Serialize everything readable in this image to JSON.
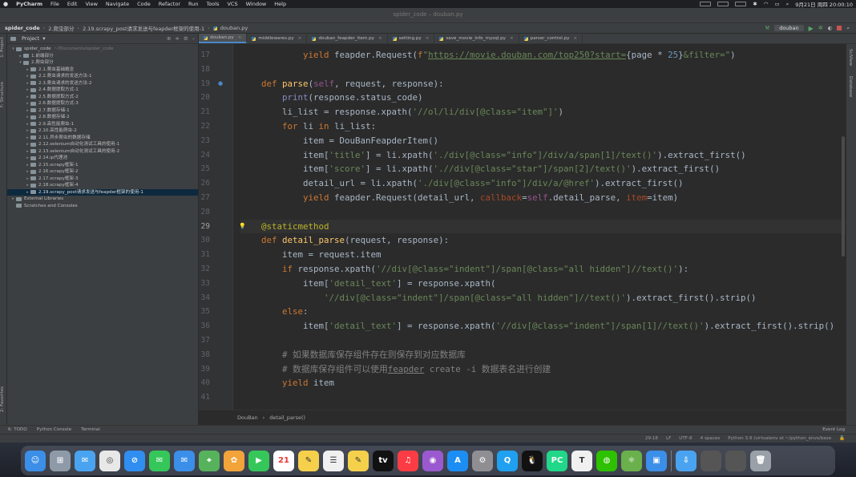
{
  "menubar": {
    "apple": "",
    "app": "PyCharm",
    "items": [
      "File",
      "Edit",
      "View",
      "Navigate",
      "Code",
      "Refactor",
      "Run",
      "Tools",
      "VCS",
      "Window",
      "Help"
    ],
    "datetime": "9月21日 周四  20:00:10"
  },
  "window": {
    "title": "spider_code – douban.py"
  },
  "navbar": {
    "crumbs": [
      "spider_code",
      "2.爬虫部分",
      "2.19.scrapy_post请求发送与feapder框架的使用-1",
      "douban.py"
    ],
    "run_config": "douban"
  },
  "project": {
    "header": "Project",
    "tree": [
      {
        "indent": 0,
        "arrow": "▾",
        "label": "spider_code",
        "muted": "~/Documents/spider_code"
      },
      {
        "indent": 1,
        "arrow": "▸",
        "label": "1.前端部分"
      },
      {
        "indent": 1,
        "arrow": "▾",
        "label": "2.爬虫部分"
      },
      {
        "indent": 2,
        "arrow": "▸",
        "label": "2.1.爬虫基础概念"
      },
      {
        "indent": 2,
        "arrow": "▸",
        "label": "2.2.爬虫请求的发送方法-1"
      },
      {
        "indent": 2,
        "arrow": "▸",
        "label": "2.3.爬虫请求的发送方法-2"
      },
      {
        "indent": 2,
        "arrow": "▸",
        "label": "2.4.数据提取方式-1"
      },
      {
        "indent": 2,
        "arrow": "▸",
        "label": "2.5.数据提取方式-2"
      },
      {
        "indent": 2,
        "arrow": "▸",
        "label": "2.6.数据提取方式-3"
      },
      {
        "indent": 2,
        "arrow": "▸",
        "label": "2.7.数据存储-1"
      },
      {
        "indent": 2,
        "arrow": "▸",
        "label": "2.8.数据存储-2"
      },
      {
        "indent": 2,
        "arrow": "▸",
        "label": "2.9.高性能爬虫-1"
      },
      {
        "indent": 2,
        "arrow": "▸",
        "label": "2.10.高性能爬虫-2"
      },
      {
        "indent": 2,
        "arrow": "▸",
        "label": "2.11.异步爬虫的数据存储"
      },
      {
        "indent": 2,
        "arrow": "▸",
        "label": "2.12.selenium自动化测试工具的使用-1"
      },
      {
        "indent": 2,
        "arrow": "▸",
        "label": "2.13.selenium自动化测试工具的使用-2"
      },
      {
        "indent": 2,
        "arrow": "▸",
        "label": "2.14.ip代理池"
      },
      {
        "indent": 2,
        "arrow": "▸",
        "label": "2.15.scrapy框架-1"
      },
      {
        "indent": 2,
        "arrow": "▸",
        "label": "2.16.scrapy框架-2"
      },
      {
        "indent": 2,
        "arrow": "▸",
        "label": "2.17.scrapy框架-3"
      },
      {
        "indent": 2,
        "arrow": "▸",
        "label": "2.18.scrapy框架-4"
      },
      {
        "indent": 2,
        "arrow": "▸",
        "label": "2.19.scrapy_post请求发送与feapder框架的使用-1",
        "selected": true
      },
      {
        "indent": 0,
        "arrow": "▸",
        "label": "External Libraries"
      },
      {
        "indent": 0,
        "arrow": "",
        "label": "Scratches and Consoles"
      }
    ]
  },
  "tabs": [
    {
      "label": "douban.py",
      "active": true
    },
    {
      "label": "middlewares.py"
    },
    {
      "label": "douban_feapder_item.py"
    },
    {
      "label": "setting.py"
    },
    {
      "label": "save_movie_info_mysql.py"
    },
    {
      "label": "parser_control.py"
    }
  ],
  "editor": {
    "line_numbers": [
      "17",
      "18",
      "19",
      "20",
      "21",
      "22",
      "23",
      "24",
      "25",
      "26",
      "27",
      "28",
      "29",
      "30",
      "31",
      "32",
      "33",
      "34",
      "35",
      "36",
      "37",
      "38",
      "39",
      "40",
      "41"
    ],
    "current_line": "29"
  },
  "crumbbar": [
    "DouBan",
    "detail_parse()"
  ],
  "bottom_tools": [
    "6: TODO",
    "Python Console",
    "Terminal"
  ],
  "event_log": "Event Log",
  "status": [
    "29:18",
    "LF",
    "UTF-8",
    "4 spaces",
    "Python 3.9 (virtualenv at ~/python_envs/base"
  ],
  "side_labels": {
    "project": "1: Project",
    "structure": "7: Structure",
    "favorites": "2: Favorites",
    "sciview": "SciView",
    "database": "Database"
  },
  "dock": [
    "Finder",
    "Launchpad",
    "Messages",
    "Chrome",
    "Safari",
    "Messages",
    "Mail",
    "Maps",
    "Photos",
    "FaceTime",
    "Calendar",
    "Notes",
    "Reminders",
    "Notes",
    "TV",
    "Music",
    "Podcasts",
    "App Store",
    "System Preferences",
    "QQ Browser",
    "QQ",
    "PyCharm",
    "Typora",
    "WeChat",
    "Atom",
    "Preview"
  ],
  "calendar_day": "21"
}
